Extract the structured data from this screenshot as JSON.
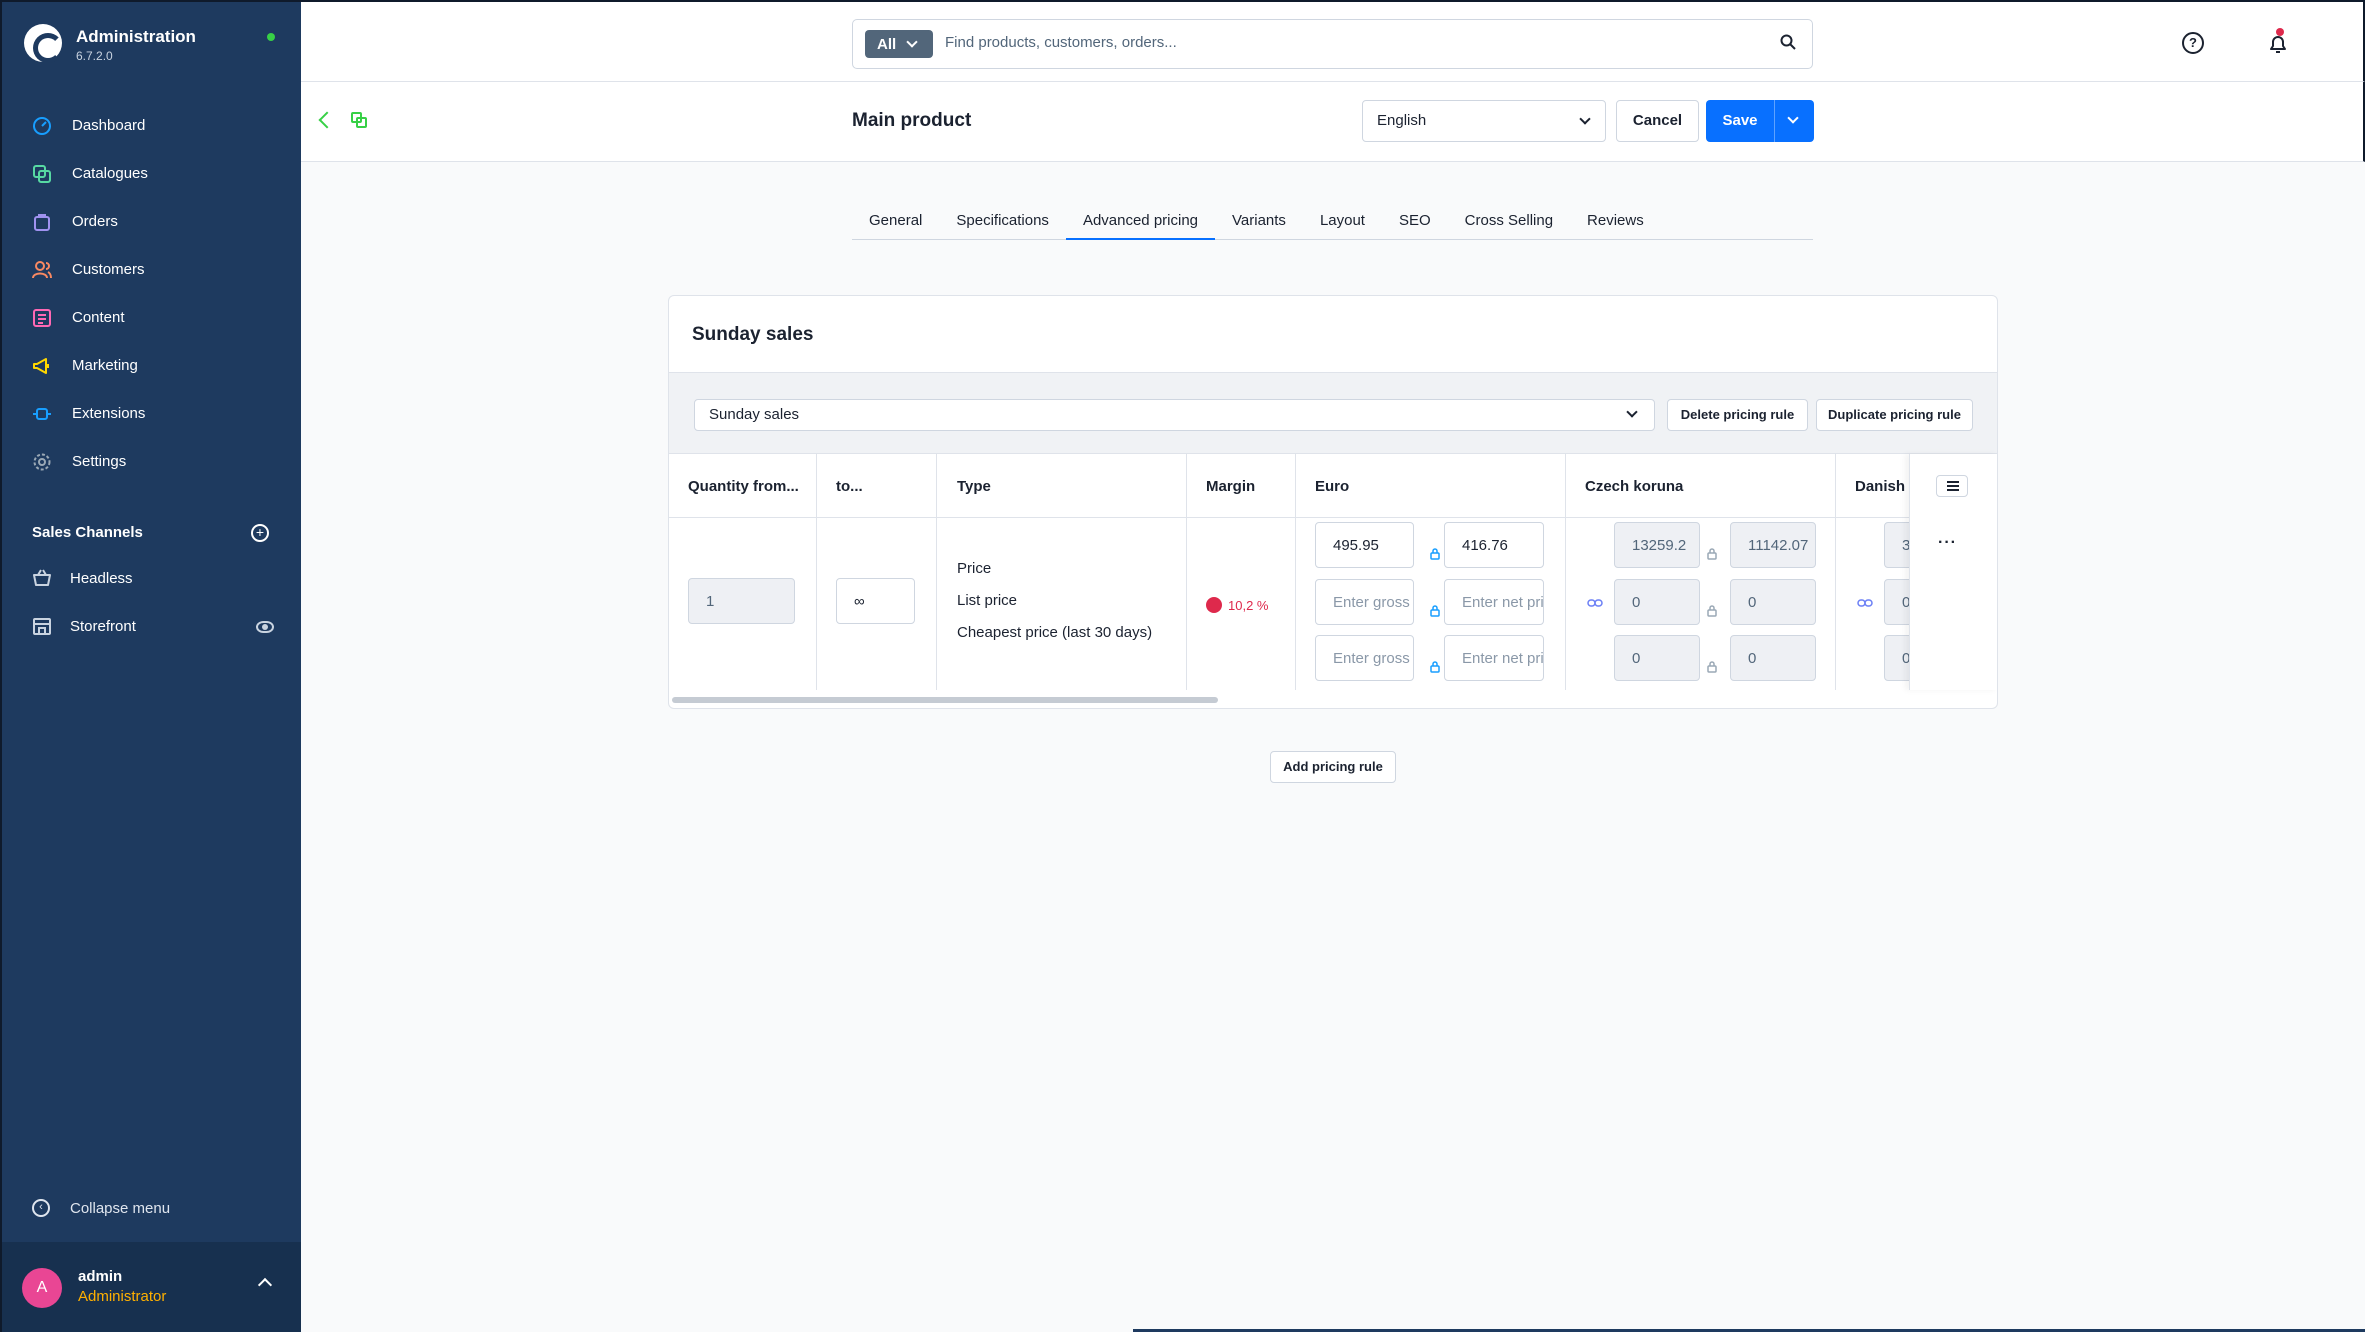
{
  "app": {
    "title": "Administration",
    "version": "6.7.2.0",
    "status_color": "#37d046"
  },
  "sidebar": {
    "items": [
      {
        "label": "Dashboard",
        "icon": "gauge-icon",
        "color": "#189eff"
      },
      {
        "label": "Catalogues",
        "icon": "products-icon",
        "color": "#57d9a3"
      },
      {
        "label": "Orders",
        "icon": "shopping-bag-icon",
        "color": "#a092f0"
      },
      {
        "label": "Customers",
        "icon": "users-icon",
        "color": "#f88962"
      },
      {
        "label": "Content",
        "icon": "content-icon",
        "color": "#ff68b4"
      },
      {
        "label": "Marketing",
        "icon": "megaphone-icon",
        "color": "#ffd700"
      },
      {
        "label": "Extensions",
        "icon": "plug-icon",
        "color": "#189eff"
      },
      {
        "label": "Settings",
        "icon": "gear-icon",
        "color": "#9aa8b5"
      }
    ],
    "sales_channels_title": "Sales Channels",
    "sales_channels": [
      {
        "label": "Headless",
        "icon": "basket-icon"
      },
      {
        "label": "Storefront",
        "icon": "storefront-icon"
      }
    ],
    "collapse_label": "Collapse menu",
    "user": {
      "initial": "A",
      "name": "admin",
      "role": "Administrator"
    }
  },
  "search": {
    "type": "All",
    "placeholder": "Find products, customers, orders..."
  },
  "smartbar": {
    "title": "Main product",
    "language": "English",
    "cancel_label": "Cancel",
    "save_label": "Save"
  },
  "tabs": [
    {
      "label": "General",
      "active": false
    },
    {
      "label": "Specifications",
      "active": false
    },
    {
      "label": "Advanced pricing",
      "active": true
    },
    {
      "label": "Variants",
      "active": false
    },
    {
      "label": "Layout",
      "active": false
    },
    {
      "label": "SEO",
      "active": false
    },
    {
      "label": "Cross Selling",
      "active": false
    },
    {
      "label": "Reviews",
      "active": false
    }
  ],
  "pricing_card": {
    "title": "Sunday sales",
    "rule_select_value": "Sunday sales",
    "delete_label": "Delete pricing rule",
    "duplicate_label": "Duplicate pricing rule",
    "columns": {
      "quantity_from": "Quantity from...",
      "to": "to...",
      "type": "Type",
      "margin": "Margin",
      "euro": "Euro",
      "czk": "Czech koruna",
      "dkk": "Danish"
    },
    "row": {
      "quantity_from": "1",
      "to": "∞",
      "types": [
        "Price",
        "List price",
        "Cheapest price (last 30 days)"
      ],
      "margin": "10,2 %",
      "euro": {
        "price_gross": "495.95",
        "price_net": "416.76",
        "gross_placeholder": "Enter gross price...",
        "net_placeholder": "Enter net price..."
      },
      "czk": {
        "price_gross": "13259.2",
        "price_net": "11142.07",
        "list_gross": "0",
        "list_net": "0",
        "cheapest_gross": "0",
        "cheapest_net": "0"
      },
      "dkk": {
        "price_gross": "3",
        "list_gross": "0",
        "cheapest_gross": "0"
      }
    },
    "add_rule_label": "Add pricing rule"
  }
}
